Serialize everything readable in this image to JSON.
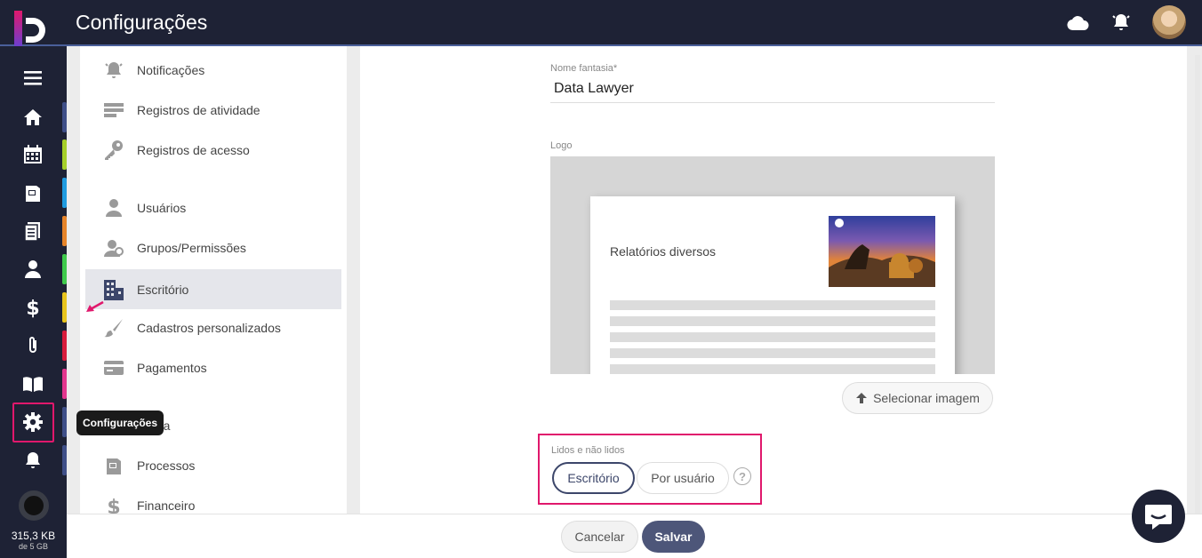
{
  "header": {
    "title": "Configurações",
    "icons": [
      "cloud-icon",
      "bell-icon"
    ]
  },
  "rail": {
    "items": [
      {
        "name": "menu-icon",
        "bar": ""
      },
      {
        "name": "home-icon",
        "bar": "#3f4f88"
      },
      {
        "name": "calendar-icon",
        "bar": "#a5cf2a"
      },
      {
        "name": "folder-icon",
        "bar": "#1f9be0"
      },
      {
        "name": "document-icon",
        "bar": "#e6842a"
      },
      {
        "name": "user-icon",
        "bar": "#3fca4c"
      },
      {
        "name": "dollar-icon",
        "bar": "#e8c41d"
      },
      {
        "name": "attachment-icon",
        "bar": "#d81b3c"
      },
      {
        "name": "book-icon",
        "bar": "#e2368e"
      },
      {
        "name": "gear-icon",
        "bar": "#3f4f88"
      },
      {
        "name": "bell-icon",
        "bar": "#3f4f88"
      }
    ],
    "tooltip": "Configurações",
    "storage": {
      "used": "315,3 KB",
      "total": "de 5 GB"
    }
  },
  "menu": {
    "items": [
      {
        "label": "Notificações",
        "icon": "bell-icon"
      },
      {
        "label": "Registros de atividade",
        "icon": "list-icon"
      },
      {
        "label": "Registros de acesso",
        "icon": "key-icon"
      },
      {
        "label": "Usuários",
        "icon": "user-icon"
      },
      {
        "label": "Grupos/Permissões",
        "icon": "group-icon"
      },
      {
        "label": "Escritório",
        "icon": "building-icon"
      },
      {
        "label": "Cadastros personalizados",
        "icon": "brush-icon"
      },
      {
        "label": "Pagamentos",
        "icon": "card-icon"
      },
      {
        "label": "nda",
        "icon": "calendar-icon"
      },
      {
        "label": "Processos",
        "icon": "folder-icon"
      },
      {
        "label": "Financeiro",
        "icon": "dollar-icon"
      }
    ],
    "active": "Escritório"
  },
  "form": {
    "nome_label": "Nome fantasia*",
    "nome_value": "Data Lawyer",
    "logo_label": "Logo",
    "preview_title": "Relatórios diversos",
    "select_image": "Selecionar imagem",
    "lidos_label": "Lidos e não lidos",
    "option_escritorio": "Escritório",
    "option_usuario": "Por usuário",
    "help": "?"
  },
  "footer": {
    "cancel": "Cancelar",
    "save": "Salvar"
  }
}
